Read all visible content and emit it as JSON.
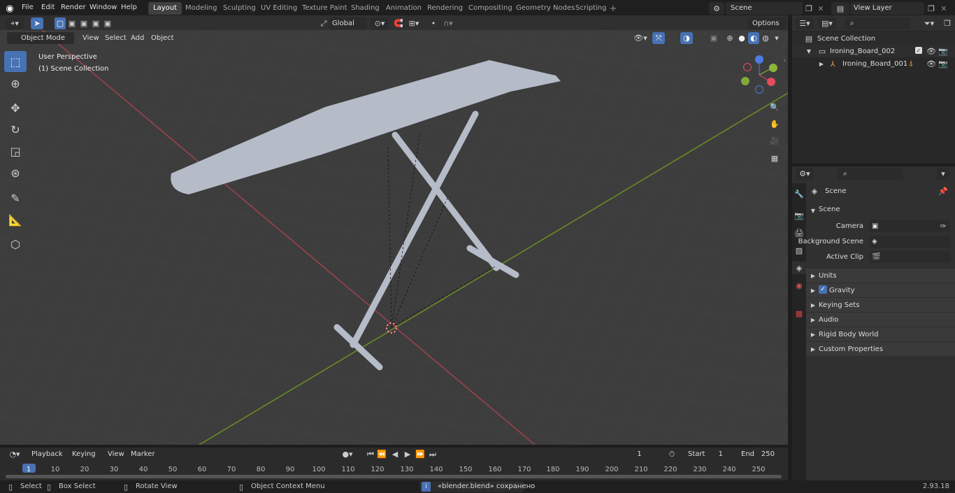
{
  "menu": {
    "file": "File",
    "edit": "Edit",
    "render": "Render",
    "window": "Window",
    "help": "Help"
  },
  "workspaces": [
    "Layout",
    "Modeling",
    "Sculpting",
    "UV Editing",
    "Texture Paint",
    "Shading",
    "Animation",
    "Rendering",
    "Compositing",
    "Geometry Nodes",
    "Scripting"
  ],
  "scene_name": "Scene",
  "view_layer": "View Layer",
  "viewport": {
    "mode": "Object Mode",
    "view": "View",
    "select": "Select",
    "add": "Add",
    "object": "Object",
    "transform": "Global",
    "options": "Options",
    "perspective": "User Perspective",
    "collection": "(1) Scene Collection"
  },
  "outliner": {
    "root": "Scene Collection",
    "items": [
      {
        "name": "Ironing_Board_002"
      },
      {
        "name": "Ironing_Board_001"
      }
    ]
  },
  "properties": {
    "title": "Scene",
    "section": "Scene",
    "camera_label": "Camera",
    "bg_label": "Background Scene",
    "clip_label": "Active Clip",
    "panels": [
      "Units",
      "Gravity",
      "Keying Sets",
      "Audio",
      "Rigid Body World",
      "Custom Properties"
    ]
  },
  "timeline": {
    "playback": "Playback",
    "keying": "Keying",
    "view": "View",
    "marker": "Marker",
    "current": "1",
    "start_label": "Start",
    "start": "1",
    "end_label": "End",
    "end": "250",
    "ticks": [
      "1",
      "10",
      "20",
      "30",
      "40",
      "50",
      "60",
      "70",
      "80",
      "90",
      "100",
      "110",
      "120",
      "130",
      "140",
      "150",
      "160",
      "170",
      "180",
      "190",
      "200",
      "210",
      "220",
      "230",
      "240",
      "250"
    ]
  },
  "status": {
    "select": "Select",
    "box": "Box Select",
    "rotate": "Rotate View",
    "context": "Object Context Menu",
    "message": "«blender.blend» сохранено",
    "version": "2.93.18"
  },
  "colors": {
    "accent": "#4772b3",
    "x_axis": "#a3424c",
    "y_axis": "#6b8e23"
  }
}
